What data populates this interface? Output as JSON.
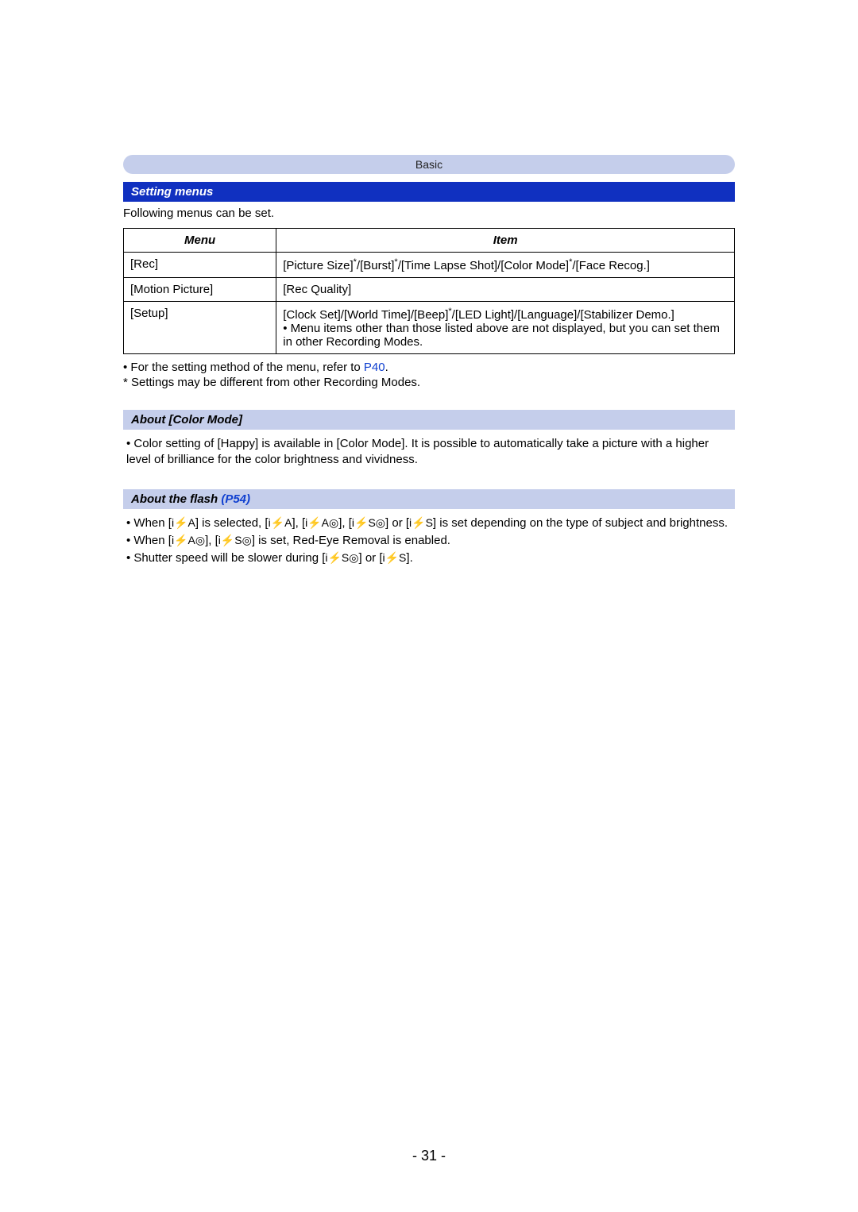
{
  "chapter": "Basic",
  "section_title": "Setting menus",
  "intro": "Following menus can be set.",
  "table": {
    "headers": [
      "Menu",
      "Item"
    ],
    "rows": [
      {
        "menu": "[Rec]",
        "item": "[Picture Size]*/[Burst]*/[Time Lapse Shot]/[Color Mode]*/[Face Recog.]"
      },
      {
        "menu": "[Motion Picture]",
        "item": "[Rec Quality]"
      },
      {
        "menu": "[Setup]",
        "item": "[Clock Set]/[World Time]/[Beep]*/[LED Light]/[Language]/[Stabilizer Demo.]\n• Menu items other than those listed above are not displayed, but you can set them in other Recording Modes."
      }
    ]
  },
  "notes": {
    "line1_prefix": "• For the setting method of the menu, refer to ",
    "line1_link": "P40",
    "line1_suffix": ".",
    "line2": "*   Settings may be different from other Recording Modes."
  },
  "color_mode": {
    "heading": "About [Color Mode]",
    "body": "• Color setting of [Happy] is available in [Color Mode]. It is possible to automatically take a picture with a higher level of brilliance for the color brightness and vividness."
  },
  "flash": {
    "heading_prefix": "About the flash ",
    "heading_link": "(P54)",
    "b1_p1": "• When [",
    "b1_i1": "i⚡A",
    "b1_p2": "] is selected, [",
    "b1_i2": "i⚡A",
    "b1_p3": "], [",
    "b1_i3": "i⚡A◎",
    "b1_p4": "], [",
    "b1_i4": "i⚡S◎",
    "b1_p5": "] or [",
    "b1_i5": "i⚡S",
    "b1_p6": "] is set depending on the type of subject and brightness.",
    "b2_p1": "• When [",
    "b2_i1": "i⚡A◎",
    "b2_p2": "], [",
    "b2_i2": "i⚡S◎",
    "b2_p3": "] is set, Red-Eye Removal is enabled.",
    "b3_p1": "• Shutter speed will be slower during [",
    "b3_i1": "i⚡S◎",
    "b3_p2": "] or [",
    "b3_i2": "i⚡S",
    "b3_p3": "]."
  },
  "page_number": "- 31 -"
}
